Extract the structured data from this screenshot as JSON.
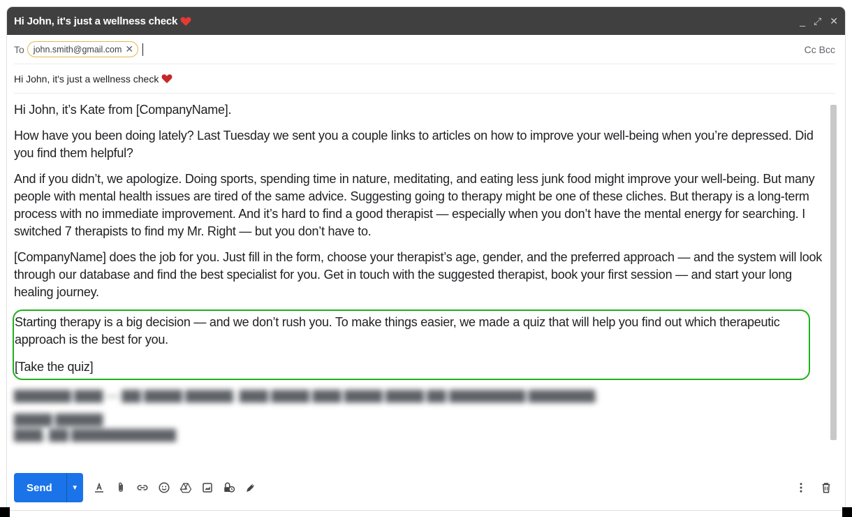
{
  "window": {
    "title": "Hi John, it's just a wellness check",
    "controls": [
      "_",
      "⤢",
      "✕"
    ]
  },
  "to": {
    "label": "To",
    "recipient": "john.smith@gmail.com",
    "cc_label": "Cc",
    "bcc_label": "Bcc"
  },
  "subject": {
    "text": "Hi John, it's just a wellness check"
  },
  "body": {
    "greeting": "Hi John, it’s Kate from [CompanyName].",
    "p1": "How have you been doing lately? Last Tuesday we sent you a couple links to articles on how to improve your well-being when you’re depressed. Did you find them helpful?",
    "p2": "And if you didn’t, we apologize. Doing sports, spending time in nature, meditating, and eating less junk food might improve your well-being. But many people with mental health issues are tired of the same advice. Suggesting going to therapy might be one of these cliches. But therapy is a long-term process with no immediate improvement. And it’s hard to find a good therapist — especially when you don’t have the mental energy for searching. I switched 7 therapists to find my Mr. Right — but you don’t have to.",
    "p3": "[CompanyName] does the job for you. Just fill in the form, choose your therapist’s age, gender, and the preferred approach — and the system will look through our database and find the best specialist for you. Get in touch with the suggested therapist, book your first session — and start your long healing journey.",
    "highlight_p": "Starting therapy is a big decision — and we don’t rush you. To make things easier, we made a quiz that will help you find out which therapeutic approach is the best for you.",
    "cta": "[Take the quiz]"
  },
  "toolbar": {
    "send_label": "Send"
  },
  "colors": {
    "titlebar": "#404040",
    "send": "#1a73e8",
    "highlight_border": "#20b01a",
    "chip_border": "#e0b84a",
    "heart": "#d93025"
  }
}
